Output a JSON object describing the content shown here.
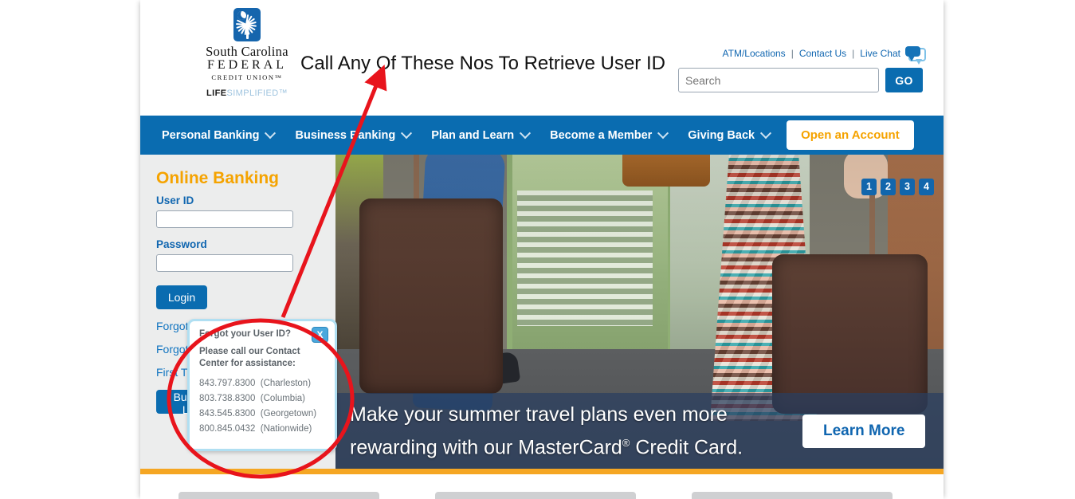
{
  "brand": {
    "logo_line1": "South Carolina",
    "logo_line2": "FEDERAL",
    "logo_line3": "CREDIT UNION™",
    "tagline_bold": "LIFE",
    "tagline_light": "SIMPLIFIED™",
    "logo_icon": "palmetto-flag-icon"
  },
  "utility": {
    "links": [
      "ATM/Locations",
      "Contact Us",
      "Live Chat"
    ],
    "separator": "|",
    "chat_icon": "chat-bubble-icon"
  },
  "search": {
    "placeholder": "Search",
    "value": "",
    "go_label": "GO"
  },
  "mainnav": {
    "items": [
      {
        "label": "Personal Banking",
        "has_caret": true
      },
      {
        "label": "Business Banking",
        "has_caret": true
      },
      {
        "label": "Plan and Learn",
        "has_caret": true
      },
      {
        "label": "Become a Member",
        "has_caret": true
      },
      {
        "label": "Giving Back",
        "has_caret": true
      }
    ],
    "cta_label": "Open an Account"
  },
  "login": {
    "title": "Online Banking",
    "userid_label": "User ID",
    "userid_value": "",
    "password_label": "Password",
    "password_value": "",
    "login_label": "Login",
    "links": [
      "Forgot User ID?",
      "Forgot Password?",
      "First Time User?"
    ],
    "business_label": "Business Login"
  },
  "popup": {
    "title": "Forgot your User ID?",
    "subtitle": "Please call our Contact Center for assistance:",
    "close_label": "X",
    "phones": [
      {
        "number": "843.797.8300",
        "location": "(Charleston)"
      },
      {
        "number": "803.738.8300",
        "location": "(Columbia)"
      },
      {
        "number": "843.545.8300",
        "location": "(Georgetown)"
      },
      {
        "number": "800.845.0432",
        "location": "(Nationwide)"
      }
    ]
  },
  "hero": {
    "caption_line1": "Make your summer travel plans even more",
    "caption_line2_a": "rewarding with our MasterCard",
    "caption_reg": "®",
    "caption_line2_b": " Credit Card.",
    "learn_more_label": "Learn More",
    "carousel_slides": [
      "1",
      "2",
      "3",
      "4"
    ],
    "active_slide": "1"
  },
  "annotation": {
    "text": "Call Any Of These Nos To Retrieve User ID",
    "color": "#e8141c",
    "arrow": "red-arrow",
    "ellipse": "red-ellipse-highlight"
  },
  "colors": {
    "nav_blue": "#0a6cb0",
    "accent_orange": "#f5a300",
    "sidebar_grey": "#eceded",
    "link_blue": "#1174c0",
    "annotation_red": "#e8141c"
  }
}
